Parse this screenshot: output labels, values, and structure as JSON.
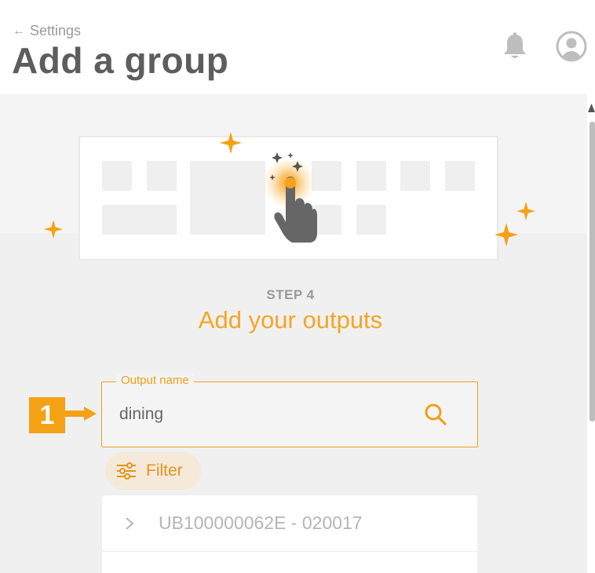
{
  "header": {
    "back_label": "Settings",
    "back_icon": "arrow-left-icon",
    "title": "Add a group",
    "notification_icon": "bell-icon",
    "account_icon": "user-avatar-icon"
  },
  "step": {
    "label": "STEP 4",
    "title": "Add your outputs"
  },
  "search": {
    "label": "Output name",
    "value": "dining",
    "icon": "search-icon"
  },
  "filter": {
    "label": "Filter",
    "icon": "sliders-icon"
  },
  "results": [
    {
      "label": "UB100000062E - 020017"
    }
  ],
  "annotation": {
    "number": "1"
  },
  "colors": {
    "accent": "#f5a524",
    "accent_dark": "#e3951c",
    "title_text": "#5d5d5d",
    "muted_text": "#9a9a9a",
    "panel_bg": "#f4f4f4",
    "filter_bg": "#f5e9da"
  }
}
